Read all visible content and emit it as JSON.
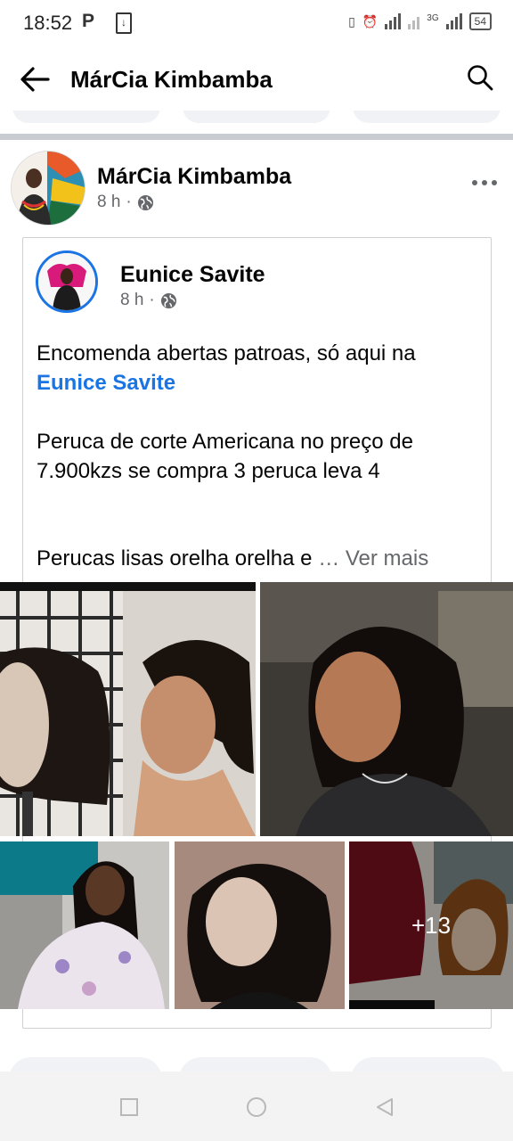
{
  "status": {
    "time": "18:52",
    "network": "3G",
    "battery": "54"
  },
  "appbar": {
    "title": "MárCia Kimbamba"
  },
  "post": {
    "author": "MárCia Kimbamba",
    "time": "8 h",
    "dot": "·",
    "shared": {
      "page_name": "Eunice Savite",
      "time": "8 h",
      "dot": "·",
      "text_line1": "Encomenda abertas patroas, só aqui na",
      "mention": "Eunice Savite",
      "text_p2": "Peruca de corte Americana no preço de 7.900kzs se compra 3 peruca leva 4",
      "text_p3": "Perucas lisas orelha orelha e",
      "ellipsis": "…",
      "see_more": "Ver mais",
      "more_photos": "+13"
    }
  },
  "colors": {
    "accent": "#1b74e4",
    "meta": "#65676b",
    "separator": "#c9ccd1"
  },
  "icons": [
    "back-arrow-icon",
    "search-icon",
    "globe-icon",
    "more-dots-icon",
    "nav-recent-icon",
    "nav-home-icon",
    "nav-back-icon"
  ]
}
